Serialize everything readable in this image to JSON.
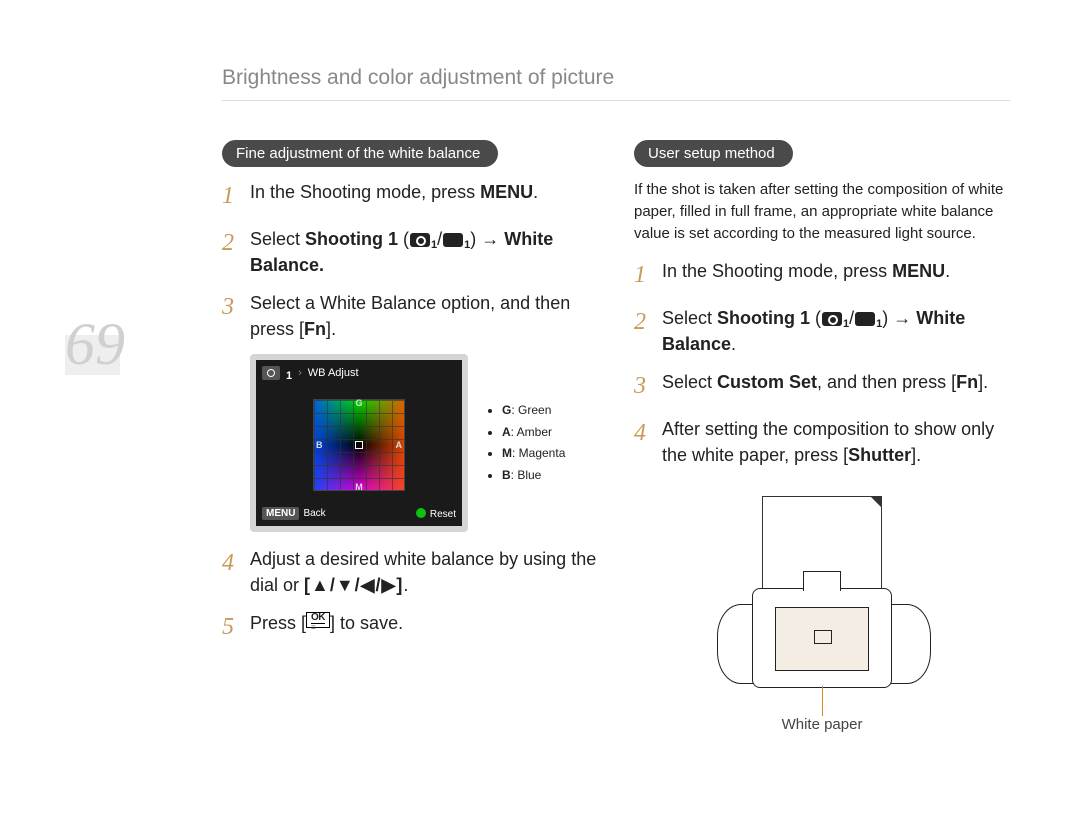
{
  "page_number": "69",
  "header": "Brightness and color adjustment of picture",
  "left": {
    "pill": "Fine adjustment of the white balance",
    "steps": [
      {
        "num": "1",
        "pre": "In the Shooting mode, press ",
        "bold": "MENU",
        "post": "."
      },
      {
        "num": "2",
        "pre": "Select ",
        "bold": "Shooting 1",
        "mid": " (",
        "iconpair": true,
        "after_icons": ") → ",
        "bold2": "White Balance.",
        "post": ""
      },
      {
        "num": "3",
        "pre": "Select a White Balance option, and then press ",
        "bold": "Fn",
        "post": "."
      },
      {
        "num": "4",
        "pre": "Adjust a desired white balance by using the dial or ",
        "arrows": "[▲/▼/◀/▶]",
        "post": "."
      },
      {
        "num": "5",
        "pre": "Press ",
        "okkey": true,
        "post": " to save."
      }
    ],
    "wb_screen": {
      "icon_sub": "1",
      "title": "WB Adjust",
      "back_label": "Back",
      "menu_label": "MENU",
      "reset_label": "Reset",
      "axis": {
        "g": "G",
        "a": "A",
        "m": "M",
        "b": "B"
      }
    },
    "wb_legend": [
      {
        "k": "G",
        "v": ": Green"
      },
      {
        "k": "A",
        "v": ": Amber"
      },
      {
        "k": "M",
        "v": ": Magenta"
      },
      {
        "k": "B",
        "v": ": Blue"
      }
    ]
  },
  "right": {
    "pill": "User setup method",
    "intro": "If the shot is taken after setting the composition of white paper, filled in full frame, an appropriate white balance value is set according to the measured light source.",
    "steps": [
      {
        "num": "1",
        "pre": "In the Shooting mode, press ",
        "bold": "MENU",
        "post": "."
      },
      {
        "num": "2",
        "pre": "Select ",
        "bold": "Shooting 1",
        "mid": " (",
        "iconpair": true,
        "after_icons": ") → ",
        "bold2": "White Balance",
        "post": "."
      },
      {
        "num": "3",
        "pre": "Select ",
        "bold": "Custom Set",
        "mid2": ", and then press ",
        "bold2": "Fn",
        "post": "."
      },
      {
        "num": "4",
        "pre": "After setting the composition to show only the white paper, press ",
        "bold": "Shutter",
        "post": "."
      }
    ],
    "caption": "White paper"
  },
  "ok_key": {
    "top": "OK",
    "bot": "≡"
  }
}
